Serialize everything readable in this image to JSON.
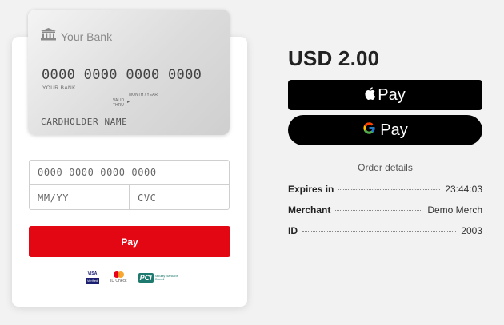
{
  "card": {
    "bank_name": "Your Bank",
    "number": "0000 0000 0000 0000",
    "bank_small": "YOUR BANK",
    "valid_thru": "VALID THRU",
    "month_year": "MONTH / YEAR",
    "holder": "CARDHOLDER NAME"
  },
  "form": {
    "card_number_placeholder": "0000 0000 0000 0000",
    "expiry_placeholder": "MM/YY",
    "cvc_placeholder": "CVC",
    "pay_label": "Pay"
  },
  "logos": {
    "visa_top": "VISA",
    "visa_bottom": "Verified",
    "mastercard_label": "ID Check",
    "pci_mark": "PCI",
    "pci_text": "Security Standards Council"
  },
  "summary": {
    "amount": "USD 2.00",
    "apple_pay_label": "Pay",
    "google_pay_label": "Pay",
    "order_details_label": "Order details",
    "details": [
      {
        "key": "Expires in",
        "value": "23:44:03"
      },
      {
        "key": "Merchant",
        "value": "Demo Merch"
      },
      {
        "key": "ID",
        "value": "2003"
      }
    ]
  },
  "colors": {
    "pay_button": "#e30613",
    "wallet_button": "#000000"
  }
}
